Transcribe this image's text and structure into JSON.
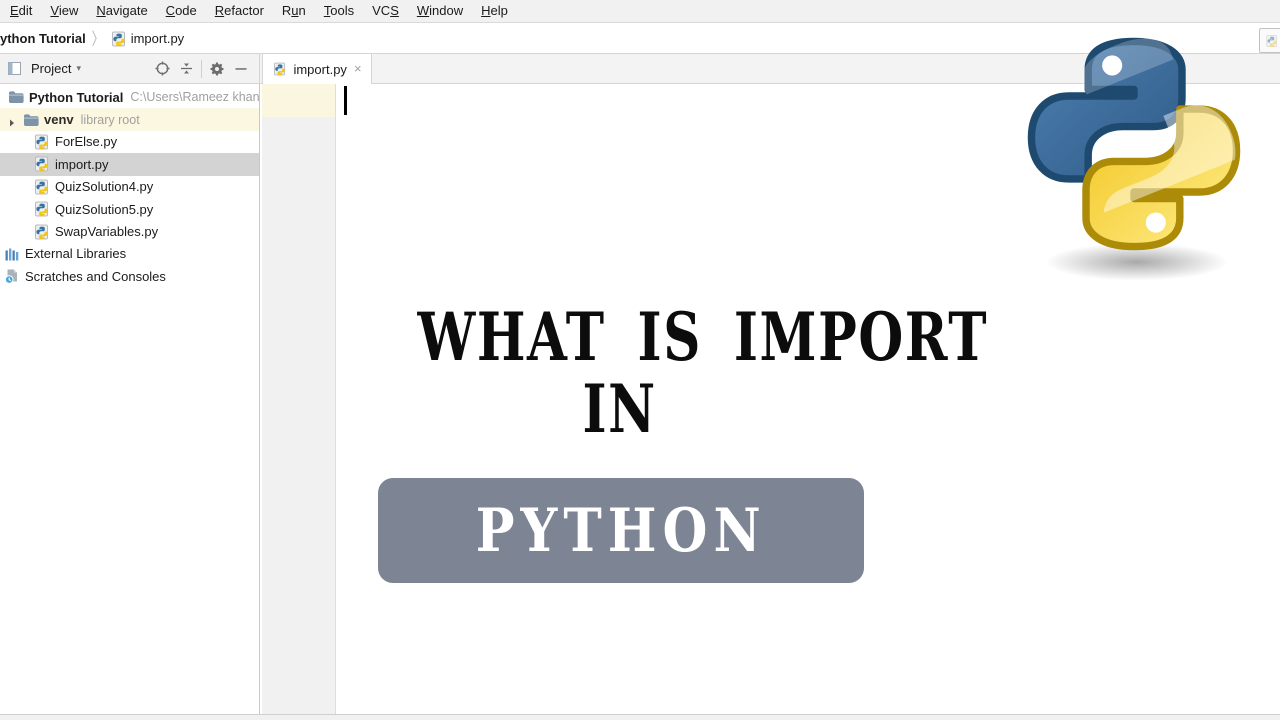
{
  "menu_bar": {
    "items": [
      {
        "label": "Edit",
        "mnemonic": 0
      },
      {
        "label": "View",
        "mnemonic": 0
      },
      {
        "label": "Navigate",
        "mnemonic": 0
      },
      {
        "label": "Code",
        "mnemonic": 0
      },
      {
        "label": "Refactor",
        "mnemonic": 0
      },
      {
        "label": "Run",
        "mnemonic": 1
      },
      {
        "label": "Tools",
        "mnemonic": 0
      },
      {
        "label": "VCS",
        "mnemonic": 2
      },
      {
        "label": "Window",
        "mnemonic": 0
      },
      {
        "label": "Help",
        "mnemonic": 0
      }
    ]
  },
  "breadcrumb": {
    "project": "ython Tutorial",
    "separator": "〉",
    "file": "import.py"
  },
  "project_panel": {
    "header": {
      "title": "Project",
      "caret": "▾"
    },
    "tree": [
      {
        "label": "Python Tutorial",
        "detail": "C:\\Users\\Rameez khan",
        "icon": "folder-icon",
        "style": "bold",
        "indent": 8
      },
      {
        "label": "venv",
        "detail": "library root",
        "icon": "folder-icon",
        "style": "semibold",
        "arrow": true,
        "highlight": true,
        "indent": 7
      },
      {
        "label": "ForElse.py",
        "icon": "python-file-icon",
        "indent": 34
      },
      {
        "label": "import.py",
        "icon": "python-file-icon",
        "selected": true,
        "indent": 34
      },
      {
        "label": "QuizSolution4.py",
        "icon": "python-file-icon",
        "indent": 34
      },
      {
        "label": "QuizSolution5.py",
        "icon": "python-file-icon",
        "indent": 34
      },
      {
        "label": "SwapVariables.py",
        "icon": "python-file-icon",
        "indent": 34
      },
      {
        "label": "External Libraries",
        "icon": "libraries-icon",
        "indent": 4
      },
      {
        "label": "Scratches and Consoles",
        "icon": "scratches-icon",
        "indent": 4
      }
    ]
  },
  "editor": {
    "tab_label": "import.py",
    "close_glyph": "×"
  },
  "overlay": {
    "title_line1": "WHAT IS IMPORT",
    "title_line2": "IN",
    "button_label": "PYTHON"
  },
  "colors": {
    "button_bg": "#7d8494",
    "selection_bg": "#d3d3d3",
    "venv_row_bg": "#fcf7e0",
    "python_blue": "#3a6e9c",
    "python_yellow": "#f5c71a"
  }
}
